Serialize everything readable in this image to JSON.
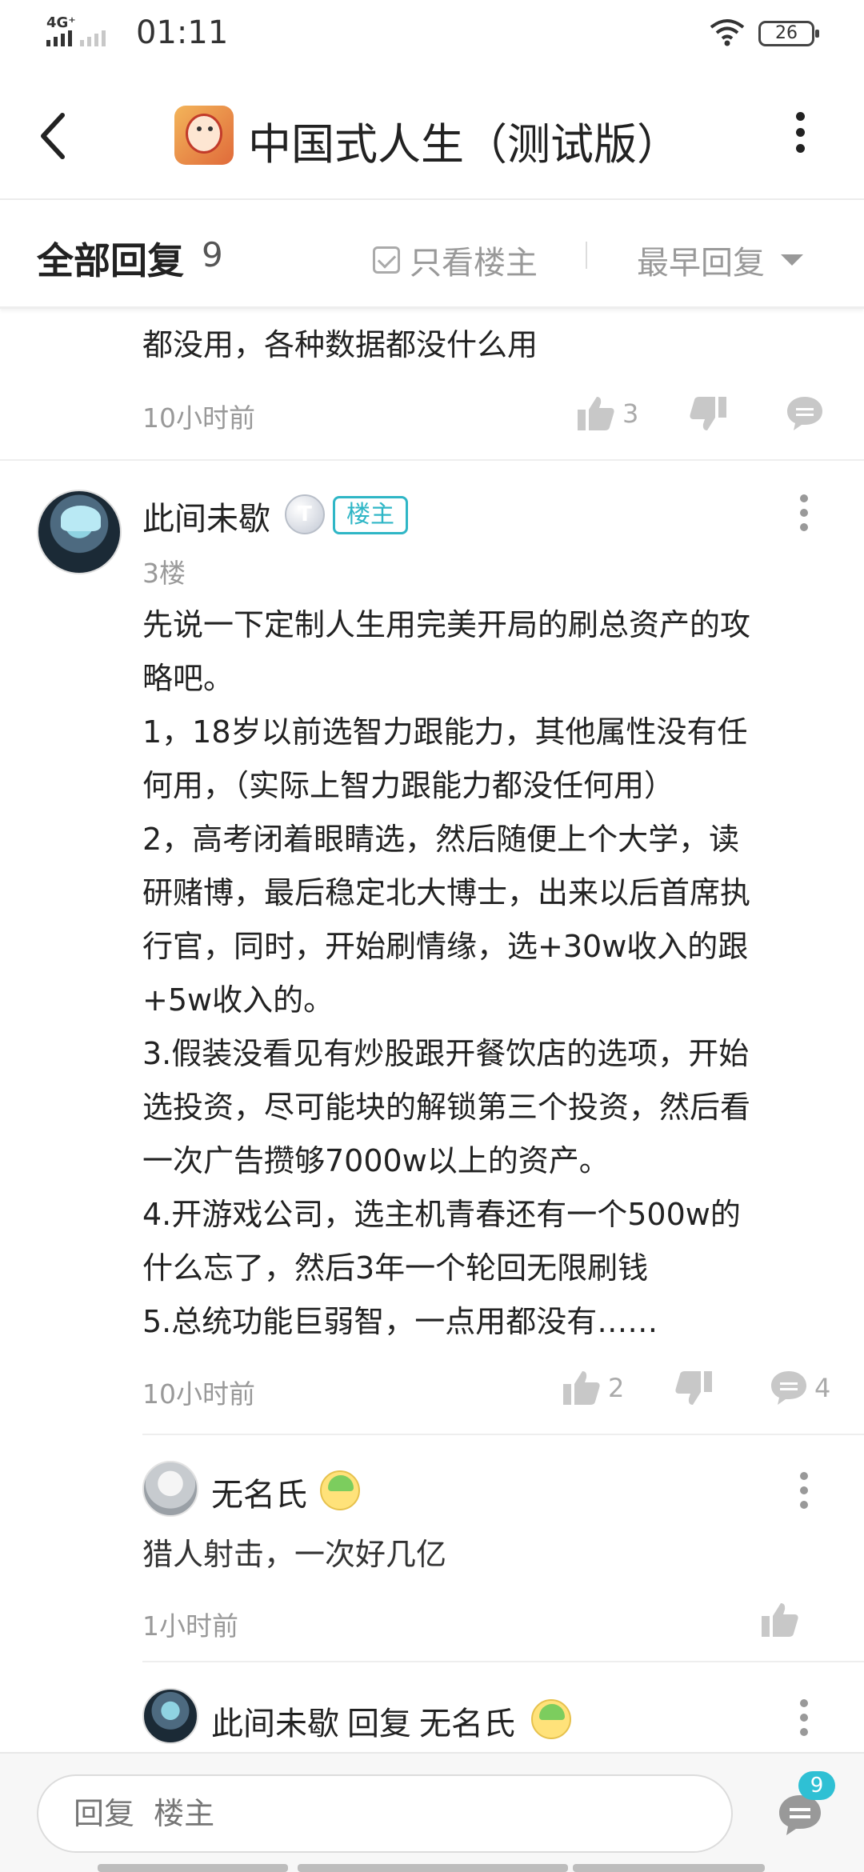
{
  "status_bar": {
    "network": "4G⁺",
    "time": "01:11",
    "battery": "26"
  },
  "header": {
    "title": "中国式人生（测试版）"
  },
  "filter_bar": {
    "title": "全部回复",
    "count": "9",
    "only_op_label": "只看楼主",
    "sort_label": "最早回复"
  },
  "previous_post": {
    "text": "都没用，各种数据都没什么用",
    "time": "10小时前",
    "likes": "3"
  },
  "main_post": {
    "author": "此间未歇",
    "level_badge": "T",
    "op_tag": "楼主",
    "floor": "3楼",
    "lines": [
      "先说一下定制人生用完美开局的刷总资产的攻",
      "略吧。",
      "1，18岁以前选智力跟能力，其他属性没有任",
      "何用，（实际上智力跟能力都没任何用）",
      "2，高考闭着眼睛选，然后随便上个大学，读",
      "研赌博，最后稳定北大博士，出来以后首席执",
      "行官，同时，开始刷情缘，选+30w收入的跟",
      "+5w收入的。",
      "3.假装没看见有炒股跟开餐饮店的选项，开始",
      "选投资，尽可能块的解锁第三个投资，然后看",
      "一次广告攒够7000w以上的资产。",
      "4.开游戏公司，选主机青春还有一个500w的",
      "什么忘了，然后3年一个轮回无限刷钱",
      "5.总统功能巨弱智，一点用都没有……"
    ],
    "time": "10小时前",
    "likes": "2",
    "comments": "4"
  },
  "sub_replies": [
    {
      "author": "无名氏",
      "text": "猎人射击，一次好几亿",
      "time": "1小时前"
    },
    {
      "author": "此间未歇",
      "reply_word": "回复",
      "reply_to": "无名氏"
    }
  ],
  "bottom_bar": {
    "placeholder": "回复  楼主",
    "comment_badge": "9"
  },
  "colors": {
    "accent": "#2fb6c6",
    "muted_text": "#999999",
    "icon_gray": "#c8c8c8"
  }
}
